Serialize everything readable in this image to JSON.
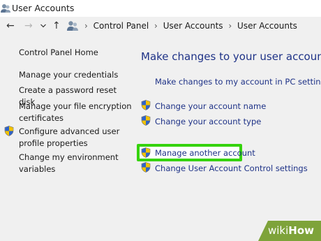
{
  "window": {
    "title": "User Accounts"
  },
  "address_bar": {
    "breadcrumbs": [
      "Control Panel",
      "User Accounts",
      "User Accounts"
    ]
  },
  "sidebar": {
    "home": "Control Panel Home",
    "items": [
      {
        "label": "Manage your credentials"
      },
      {
        "label": "Create a password reset disk"
      },
      {
        "label_line1": "Manage your file encryption",
        "label_line2": "certificates"
      },
      {
        "label_line1": "Configure advanced user",
        "label_line2": "profile properties",
        "icon": "shield-icon"
      },
      {
        "label_line1": "Change my environment",
        "label_line2": "variables"
      }
    ]
  },
  "main": {
    "heading": "Make changes to your user account",
    "pc_settings_link": "Make changes to my account in PC settings",
    "links": [
      {
        "label": "Change your account name",
        "icon": "shield-icon"
      },
      {
        "label": "Change your account type",
        "icon": "shield-icon"
      },
      {
        "label": "Manage another account",
        "icon": "shield-icon"
      },
      {
        "label": "Change User Account Control settings",
        "icon": "shield-icon"
      }
    ]
  },
  "watermark": {
    "wiki": "wiki",
    "how": "How"
  },
  "colors": {
    "link": "#1e3287",
    "highlight": "#35d30b",
    "background": "#f0f0f0",
    "watermark": "#7ea33a"
  }
}
